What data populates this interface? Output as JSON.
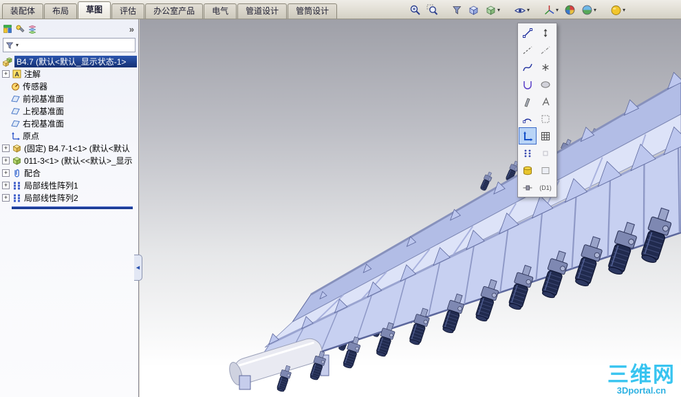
{
  "tabs": {
    "items": [
      {
        "label": "装配体"
      },
      {
        "label": "布局"
      },
      {
        "label": "草图"
      },
      {
        "label": "评估"
      },
      {
        "label": "办公室产品"
      },
      {
        "label": "电气"
      },
      {
        "label": "管道设计"
      },
      {
        "label": "管筒设计"
      }
    ],
    "active_index": 2
  },
  "toolbar": {
    "buttons": [
      "zoom-fit",
      "zoom-area",
      "selection-filter",
      "view-cube",
      "display-style",
      "hide-show-items",
      "view-orientation",
      "edit-appearance",
      "apply-scene",
      "help"
    ]
  },
  "left_panel": {
    "header_icons": [
      "feature-manager",
      "property-manager",
      "configuration-manager"
    ]
  },
  "feature_tree": {
    "root_label": "B4.7  (默认<默认_显示状态-1>",
    "items": [
      {
        "label": "注解",
        "expandable": true
      },
      {
        "label": "传感器",
        "expandable": false
      },
      {
        "label": "前视基准面",
        "expandable": false
      },
      {
        "label": "上视基准面",
        "expandable": false
      },
      {
        "label": "右视基准面",
        "expandable": false
      },
      {
        "label": "原点",
        "expandable": false
      },
      {
        "label": "(固定) B4.7-1<1> (默认<默认",
        "expandable": true
      },
      {
        "label": "011-3<1> (默认<<默认>_显示",
        "expandable": true
      },
      {
        "label": "配合",
        "expandable": true
      },
      {
        "label": "局部线性阵列1",
        "expandable": true
      },
      {
        "label": "局部线性阵列2",
        "expandable": true
      }
    ]
  },
  "sketch_palette": {
    "d1_label": "(D1)",
    "selected_tool": "ruler-tool",
    "icons": [
      "line",
      "dimension",
      "centerline",
      "construction-line",
      "spline",
      "point",
      "arc-u",
      "ellipse",
      "trim",
      "text",
      "tangent-arc",
      "hatch",
      "ruler",
      "grid",
      "pattern",
      "spacer",
      "material-db",
      "face",
      "slider"
    ]
  },
  "watermark": {
    "title": "三维网",
    "subtitle": "3Dportal.cn"
  },
  "glyphs": {
    "plus": "+",
    "chevrons": "»",
    "caret": "▾",
    "collapse_arrow": "◀",
    "annotation_letter": "A"
  },
  "colors": {
    "selection_navy": "#1b3c96",
    "watermark_cyan": "#38c4f0",
    "model_lavender": "#c7d0f1",
    "motor_navy": "#202a4e",
    "toolbar_beige": "#d5d1c5"
  }
}
